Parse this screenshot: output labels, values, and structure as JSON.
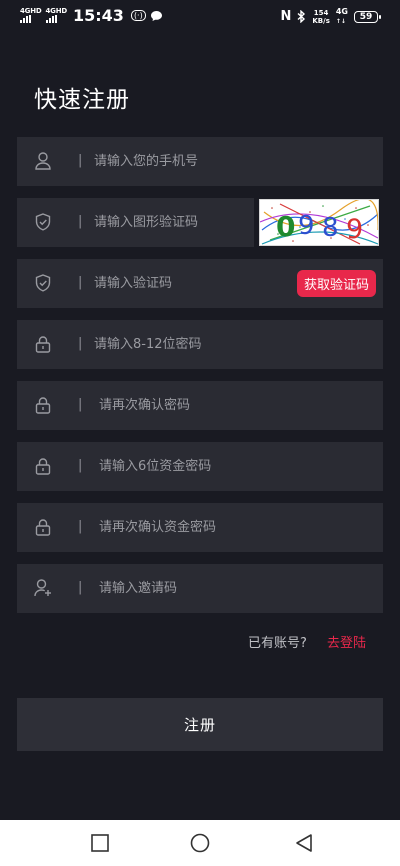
{
  "status_bar": {
    "sim1": "4G",
    "sim1_sup": "HD",
    "sim2": "4G",
    "sim2_sup": "HD",
    "time": "15:43",
    "nfc": "N",
    "speed_value": "154",
    "speed_unit": "KB/s",
    "network": "4G",
    "battery": "59"
  },
  "page": {
    "title": "快速注册"
  },
  "form": {
    "separator": "|",
    "phone_placeholder": "请输入您的手机号",
    "captcha_placeholder": "请输入图形验证码",
    "captcha_text": "0989",
    "sms_placeholder": "请输入验证码",
    "get_code_label": "获取验证码",
    "password_placeholder": "请输入8-12位密码",
    "confirm_password_placeholder": "请再次确认密码",
    "fund_password_placeholder": "请输入6位资金密码",
    "confirm_fund_password_placeholder": "请再次确认资金密码",
    "invite_placeholder": "请输入邀请码"
  },
  "login_prompt": {
    "question": "已有账号?",
    "link": "去登陆"
  },
  "register_button": "注册",
  "colors": {
    "background": "#191a22",
    "field": "#2a2b33",
    "accent": "#e8284b"
  },
  "icons": {
    "phone": "user-icon",
    "captcha": "shield-check-icon",
    "sms": "shield-check-icon",
    "password": "lock-icon",
    "invite": "add-user-icon",
    "nav": [
      "recents-square-icon",
      "home-circle-icon",
      "back-triangle-icon"
    ]
  }
}
